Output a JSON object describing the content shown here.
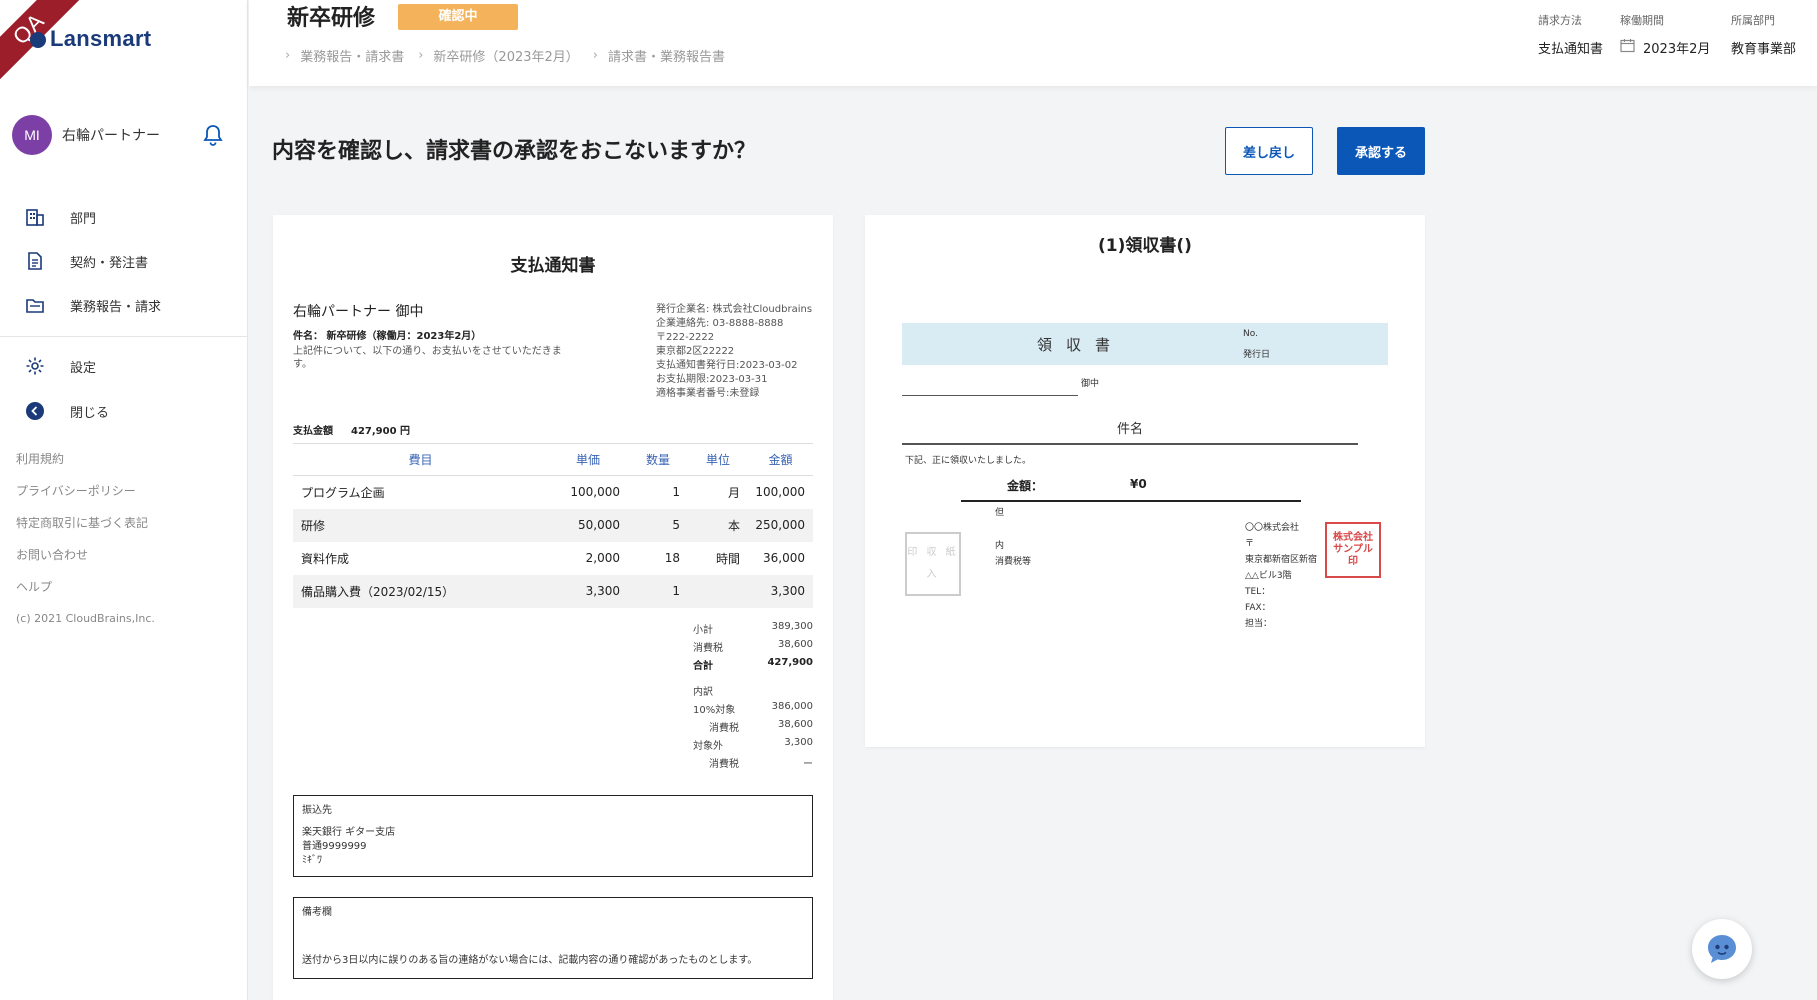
{
  "sidebar": {
    "ribbon": "QA",
    "brand": "Lansmart",
    "user": {
      "initials": "MI",
      "name": "右輪パートナー"
    },
    "nav": [
      {
        "label": "部門",
        "icon": "building-icon"
      },
      {
        "label": "契約・発注書",
        "icon": "document-icon"
      },
      {
        "label": "業務報告・請求",
        "icon": "folder-icon"
      },
      {
        "label": "設定",
        "icon": "gear-icon"
      },
      {
        "label": "閉じる",
        "icon": "arrow-left-circle-icon"
      }
    ],
    "footer": [
      "利用規約",
      "プライバシーポリシー",
      "特定商取引に基づく表記",
      "お問い合わせ",
      "ヘルプ",
      "(c) 2021 CloudBrains,Inc."
    ]
  },
  "header": {
    "title": "新卒研修",
    "status": "確認中",
    "breadcrumb": [
      "業務報告・請求書",
      "新卒研修（2023年2月）",
      "請求書・業務報告書"
    ],
    "meta": [
      {
        "label": "請求方法",
        "value": "支払通知書"
      },
      {
        "label": "稼働期間",
        "value": "2023年2月"
      },
      {
        "label": "所属部門",
        "value": "教育事業部"
      }
    ]
  },
  "main": {
    "question": "内容を確認し、請求書の承認をおこないますか？",
    "back_button": "差し戻し",
    "approve_button": "承認する"
  },
  "notice": {
    "title": "支払通知書",
    "addressee": "右輪パートナー 御中",
    "subject": "件名： 新卒研修（稼働月：2023年2月）",
    "intro": "上記件について、以下の通り、お支払いをさせていただきます。",
    "issuer": [
      "発行企業名: 株式会社Cloudbrains",
      "企業連絡先: 03-8888-8888",
      "〒222-2222",
      "東京都2区22222",
      "支払通知書発行日:2023-03-02",
      "お支払期限:2023-03-31",
      "適格事業者番号:未登録"
    ],
    "total_label": "支払金額",
    "total_value": "427,900 円",
    "columns": [
      "費目",
      "単価",
      "数量",
      "単位",
      "金額"
    ],
    "rows": [
      {
        "item": "プログラム企画",
        "price": "100,000",
        "qty": "1",
        "unit": "月",
        "amount": "100,000"
      },
      {
        "item": "研修",
        "price": "50,000",
        "qty": "5",
        "unit": "本",
        "amount": "250,000"
      },
      {
        "item": "資料作成",
        "price": "2,000",
        "qty": "18",
        "unit": "時間",
        "amount": "36,000"
      },
      {
        "item": "備品購入費（2023/02/15）",
        "price": "3,300",
        "qty": "1",
        "unit": "",
        "amount": "3,300"
      }
    ],
    "summary": {
      "subtotal_label": "小計",
      "subtotal": "389,300",
      "tax_label": "消費税",
      "tax": "38,600",
      "total_label": "合計",
      "total": "427,900",
      "breakdown_label": "内訳",
      "ten_label": "10%対象",
      "ten": "386,000",
      "ten_tax_label": "消費税",
      "ten_tax": "38,600",
      "exempt_label": "対象外",
      "exempt": "3,300",
      "exempt_tax_label": "消費税",
      "exempt_tax": "ー"
    },
    "bank": {
      "heading": "振込先",
      "line1": "楽天銀行 ギター支店",
      "line2": "普通9999999",
      "line3": "ﾐｷﾞﾜ"
    },
    "remarks": {
      "heading": "備考欄",
      "text": "送付から3日以内に誤りのある旨の連絡がない場合には、記載内容の通り確認があったものとします。"
    }
  },
  "receipt": {
    "title": "(1)領収書()",
    "header_title": "領収書",
    "no_label": "No.",
    "date_label": "発行日",
    "onchu": "御中",
    "kenmei": "件名",
    "received": "下記、正に領収いたしました。",
    "amount_label": "金額：",
    "amount_value": "¥0",
    "tadashi": "但",
    "stamp": "印 収 紙 入",
    "uchi": "内",
    "tax_note": "消費税等",
    "company": [
      "〇〇株式会社",
      "〒",
      "東京都新宿区新宿",
      "△△ビル3階",
      "TEL：",
      "FAX：",
      "担当："
    ],
    "seal_text": "株式会社サンプル印"
  },
  "colors": {
    "primary": "#0a57b8",
    "badge": "#f4b35a",
    "receipt_header": "#d9ebf3",
    "seal": "#d84a4a"
  }
}
